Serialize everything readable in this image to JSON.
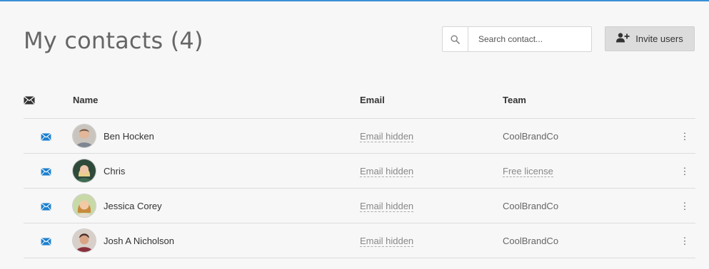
{
  "page": {
    "title": "My contacts (4)"
  },
  "search": {
    "placeholder": "Search contact...",
    "value": "",
    "icon": "search-icon"
  },
  "invite_button": {
    "label": "Invite users",
    "icon": "add-user-icon"
  },
  "colors": {
    "accent": "#1a7fcf",
    "top_line": "#3a8fd6",
    "button_bg": "#dcdcdc"
  },
  "table": {
    "headers": {
      "mail_icon": "envelope-icon",
      "name": "Name",
      "email": "Email",
      "team": "Team"
    },
    "rows": [
      {
        "name": "Ben Hocken",
        "email": "Email hidden",
        "team": "CoolBrandCo",
        "team_is_link": false
      },
      {
        "name": "Chris",
        "email": "Email hidden",
        "team": "Free license",
        "team_is_link": true
      },
      {
        "name": "Jessica Corey",
        "email": "Email hidden",
        "team": "CoolBrandCo",
        "team_is_link": false
      },
      {
        "name": "Josh A Nicholson",
        "email": "Email hidden",
        "team": "CoolBrandCo",
        "team_is_link": false
      }
    ]
  }
}
